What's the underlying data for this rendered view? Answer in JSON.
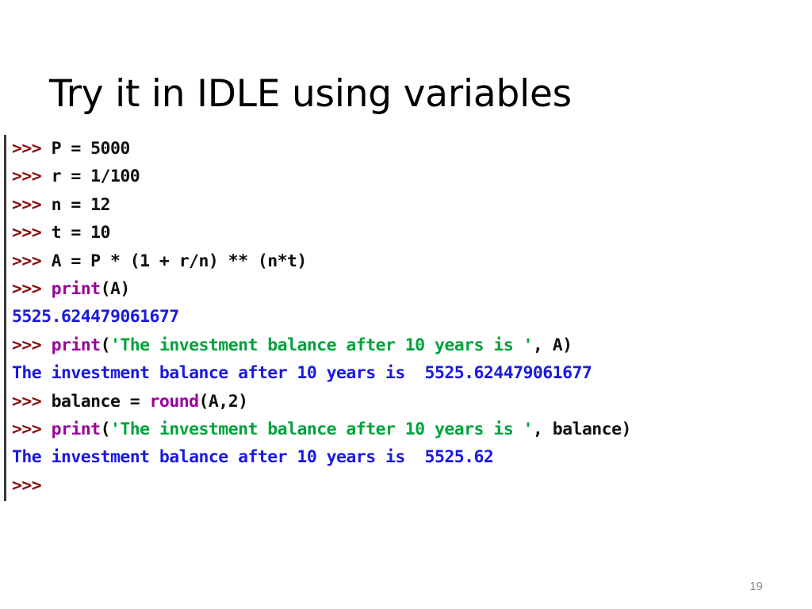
{
  "slide": {
    "title": "Try it in IDLE using variables",
    "page_number": "19",
    "background_color": "#ffffff"
  },
  "colors": {
    "prompt": "#8b0f0f",
    "code": "#101010",
    "builtin": "#9b009b",
    "string": "#00a33d",
    "output": "#1a1ae0",
    "rule": "#3a3a3a",
    "page_number": "#8c8c8c"
  },
  "shell": {
    "prompt": ">>> ",
    "lines": [
      {
        "kind": "input",
        "text": ">>> P = 5000",
        "tokens": [
          {
            "t": ">>> ",
            "c": "prompt"
          },
          {
            "t": "P = 5000",
            "c": "plain"
          }
        ]
      },
      {
        "kind": "input",
        "text": ">>> r = 1/100",
        "tokens": [
          {
            "t": ">>> ",
            "c": "prompt"
          },
          {
            "t": "r = 1/100",
            "c": "plain"
          }
        ]
      },
      {
        "kind": "input",
        "text": ">>> n = 12",
        "tokens": [
          {
            "t": ">>> ",
            "c": "prompt"
          },
          {
            "t": "n = 12",
            "c": "plain"
          }
        ]
      },
      {
        "kind": "input",
        "text": ">>> t = 10",
        "tokens": [
          {
            "t": ">>> ",
            "c": "prompt"
          },
          {
            "t": "t = 10",
            "c": "plain"
          }
        ]
      },
      {
        "kind": "input",
        "text": ">>> A = P * (1 + r/n) ** (n*t)",
        "tokens": [
          {
            "t": ">>> ",
            "c": "prompt"
          },
          {
            "t": "A = P * (1 + r/n) ** (n*t)",
            "c": "plain"
          }
        ]
      },
      {
        "kind": "input",
        "text": ">>> print(A)",
        "tokens": [
          {
            "t": ">>> ",
            "c": "prompt"
          },
          {
            "t": "print",
            "c": "builtin"
          },
          {
            "t": "(A)",
            "c": "plain"
          }
        ]
      },
      {
        "kind": "output",
        "text": "5525.624479061677",
        "tokens": [
          {
            "t": "5525.624479061677",
            "c": "output"
          }
        ]
      },
      {
        "kind": "input",
        "text": ">>> print('The investment balance after 10 years is ', A)",
        "tokens": [
          {
            "t": ">>> ",
            "c": "prompt"
          },
          {
            "t": "print",
            "c": "builtin"
          },
          {
            "t": "(",
            "c": "plain"
          },
          {
            "t": "'The investment balance after 10 years is '",
            "c": "string"
          },
          {
            "t": ", A)",
            "c": "plain"
          }
        ]
      },
      {
        "kind": "output",
        "text": "The investment balance after 10 years is  5525.624479061677",
        "tokens": [
          {
            "t": "The investment balance after 10 years is  5525.624479061677",
            "c": "output"
          }
        ]
      },
      {
        "kind": "input",
        "text": ">>> balance = round(A,2)",
        "tokens": [
          {
            "t": ">>> ",
            "c": "prompt"
          },
          {
            "t": "balance = ",
            "c": "plain"
          },
          {
            "t": "round",
            "c": "builtin"
          },
          {
            "t": "(A,2)",
            "c": "plain"
          }
        ]
      },
      {
        "kind": "input",
        "text": ">>> print('The investment balance after 10 years is ', balance)",
        "tokens": [
          {
            "t": ">>> ",
            "c": "prompt"
          },
          {
            "t": "print",
            "c": "builtin"
          },
          {
            "t": "(",
            "c": "plain"
          },
          {
            "t": "'The investment balance after 10 years is '",
            "c": "string"
          },
          {
            "t": ", balance)",
            "c": "plain"
          }
        ]
      },
      {
        "kind": "output",
        "text": "The investment balance after 10 years is  5525.62",
        "tokens": [
          {
            "t": "The investment balance after 10 years is  5525.62",
            "c": "output"
          }
        ]
      },
      {
        "kind": "input",
        "text": ">>>",
        "tokens": [
          {
            "t": ">>>",
            "c": "prompt"
          }
        ]
      }
    ]
  }
}
